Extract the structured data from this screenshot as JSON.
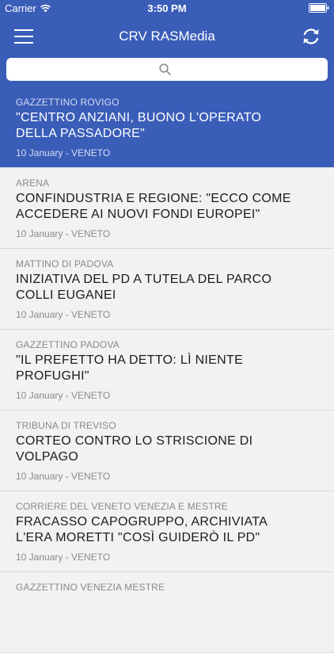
{
  "status_bar": {
    "carrier": "Carrier",
    "time": "3:50 PM"
  },
  "nav": {
    "title": "CRV RASMedia"
  },
  "colors": {
    "accent": "#3a5db8",
    "list_background": "#f2f2f2",
    "muted_text": "#8a8a8a"
  },
  "icons": [
    "wifi-icon",
    "battery-icon",
    "menu-icon",
    "refresh-icon",
    "search-icon"
  ],
  "articles": [
    {
      "source": "GAZZETTINO ROVIGO",
      "title": "\"CENTRO ANZIANI, BUONO L'OPERATO DELLA PASSADORE\"",
      "meta": "10 January - VENETO",
      "selected": true
    },
    {
      "source": "ARENA",
      "title": "CONFINDUSTRIA E REGIONE: \"ECCO COME ACCEDERE AI NUOVI FONDI EUROPEI\"",
      "meta": "10 January - VENETO"
    },
    {
      "source": "MATTINO DI PADOVA",
      "title": "INIZIATIVA DEL PD A TUTELA DEL PARCO COLLI EUGANEI",
      "meta": "10 January - VENETO"
    },
    {
      "source": "GAZZETTINO PADOVA",
      "title": "\"IL PREFETTO HA DETTO: LÌ NIENTE PROFUGHI\"",
      "meta": "10 January - VENETO"
    },
    {
      "source": "TRIBUNA DI TREVISO",
      "title": "CORTEO CONTRO LO STRISCIONE DI VOLPAGO",
      "meta": "10 January - VENETO"
    },
    {
      "source": "CORRIERE DEL VENETO VENEZIA E MESTRE",
      "title": "FRACASSO CAPOGRUPPO, ARCHIVIATA L'ERA MORETTI \"COSÌ GUIDERÒ IL PD\"",
      "meta": "10 January - VENETO"
    },
    {
      "source": "GAZZETTINO VENEZIA MESTRE",
      "title": "",
      "meta": ""
    }
  ]
}
